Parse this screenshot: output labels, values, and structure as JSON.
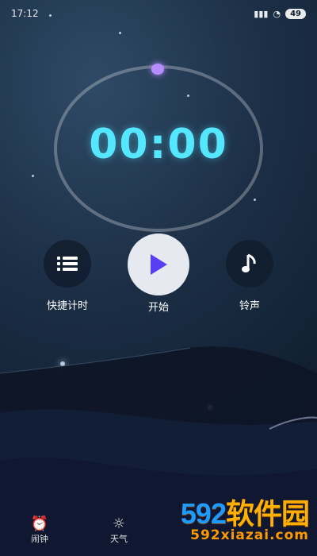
{
  "status_bar": {
    "time": "17:12",
    "battery": "49"
  },
  "timer": {
    "display": "00:00"
  },
  "controls": [
    {
      "label": "快捷计时",
      "icon": "list-icon"
    },
    {
      "label": "开始",
      "icon": "play-icon"
    },
    {
      "label": "铃声",
      "icon": "music-note-icon"
    }
  ],
  "nav": [
    {
      "label": "闹钟",
      "icon": "alarm-clock-icon"
    },
    {
      "label": "天气",
      "icon": "sun-icon"
    }
  ],
  "watermark": {
    "brand_digits": "592",
    "brand_text": "软件园",
    "url": "592xiazai.com"
  },
  "colors": {
    "time_digits": "#55e7ff",
    "knob": "#b58cff",
    "watermark_orange": "#ffb000",
    "watermark_blue": "#1e9bff"
  }
}
